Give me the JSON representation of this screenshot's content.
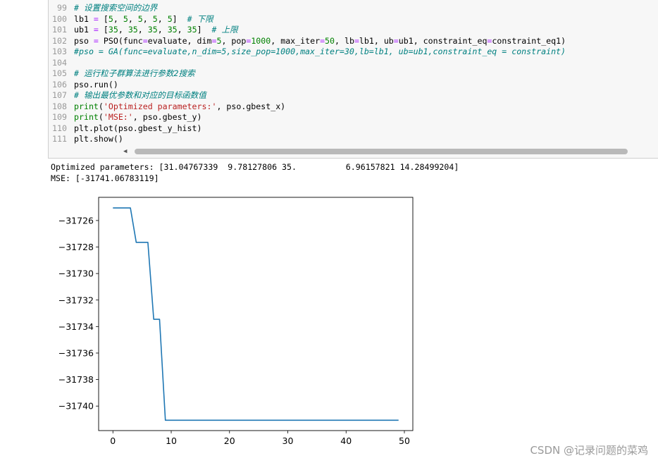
{
  "code_lines": [
    {
      "num": "99",
      "segs": [
        {
          "t": "# 设置搜索空间的边界",
          "c": "c"
        }
      ]
    },
    {
      "num": "100",
      "segs": [
        {
          "t": "lb1 ",
          "c": "src"
        },
        {
          "t": "=",
          "c": "e"
        },
        {
          "t": " [",
          "c": "src"
        },
        {
          "t": "5",
          "c": "n"
        },
        {
          "t": ", ",
          "c": "src"
        },
        {
          "t": "5",
          "c": "n"
        },
        {
          "t": ", ",
          "c": "src"
        },
        {
          "t": "5",
          "c": "n"
        },
        {
          "t": ", ",
          "c": "src"
        },
        {
          "t": "5",
          "c": "n"
        },
        {
          "t": ", ",
          "c": "src"
        },
        {
          "t": "5",
          "c": "n"
        },
        {
          "t": "]  ",
          "c": "src"
        },
        {
          "t": "# 下限",
          "c": "c"
        }
      ]
    },
    {
      "num": "101",
      "segs": [
        {
          "t": "ub1 ",
          "c": "src"
        },
        {
          "t": "=",
          "c": "e"
        },
        {
          "t": " [",
          "c": "src"
        },
        {
          "t": "35",
          "c": "n"
        },
        {
          "t": ", ",
          "c": "src"
        },
        {
          "t": "35",
          "c": "n"
        },
        {
          "t": ", ",
          "c": "src"
        },
        {
          "t": "35",
          "c": "n"
        },
        {
          "t": ", ",
          "c": "src"
        },
        {
          "t": "35",
          "c": "n"
        },
        {
          "t": ", ",
          "c": "src"
        },
        {
          "t": "35",
          "c": "n"
        },
        {
          "t": "]  ",
          "c": "src"
        },
        {
          "t": "# 上限",
          "c": "c"
        }
      ]
    },
    {
      "num": "102",
      "segs": [
        {
          "t": "pso ",
          "c": "src"
        },
        {
          "t": "=",
          "c": "e"
        },
        {
          "t": " PSO(func",
          "c": "src"
        },
        {
          "t": "=",
          "c": "e"
        },
        {
          "t": "evaluate, dim",
          "c": "src"
        },
        {
          "t": "=",
          "c": "e"
        },
        {
          "t": "5",
          "c": "n"
        },
        {
          "t": ", pop",
          "c": "src"
        },
        {
          "t": "=",
          "c": "e"
        },
        {
          "t": "1000",
          "c": "n"
        },
        {
          "t": ", max_iter",
          "c": "src"
        },
        {
          "t": "=",
          "c": "e"
        },
        {
          "t": "50",
          "c": "n"
        },
        {
          "t": ", lb",
          "c": "src"
        },
        {
          "t": "=",
          "c": "e"
        },
        {
          "t": "lb1, ub",
          "c": "src"
        },
        {
          "t": "=",
          "c": "e"
        },
        {
          "t": "ub1, constraint_eq",
          "c": "src"
        },
        {
          "t": "=",
          "c": "e"
        },
        {
          "t": "constraint_eq1)",
          "c": "src"
        }
      ]
    },
    {
      "num": "103",
      "segs": [
        {
          "t": "#pso = GA(func=evaluate,n_dim=5,size_pop=1000,max_iter=30,lb=lb1, ub=ub1,constraint_eq = constraint)",
          "c": "c"
        }
      ]
    },
    {
      "num": "104",
      "segs": []
    },
    {
      "num": "105",
      "segs": [
        {
          "t": "# 运行粒子群算法进行参数2搜索",
          "c": "c"
        }
      ]
    },
    {
      "num": "106",
      "segs": [
        {
          "t": "pso.run()",
          "c": "src"
        }
      ]
    },
    {
      "num": "107",
      "segs": [
        {
          "t": "# 输出最优参数和对应的目标函数值",
          "c": "c"
        }
      ]
    },
    {
      "num": "108",
      "segs": [
        {
          "t": "print",
          "c": "n"
        },
        {
          "t": "(",
          "c": "src"
        },
        {
          "t": "'Optimized parameters:'",
          "c": "s"
        },
        {
          "t": ", pso.gbest_x)",
          "c": "src"
        }
      ]
    },
    {
      "num": "109",
      "segs": [
        {
          "t": "print",
          "c": "n"
        },
        {
          "t": "(",
          "c": "src"
        },
        {
          "t": "'MSE:'",
          "c": "s"
        },
        {
          "t": ", pso.gbest_y)",
          "c": "src"
        }
      ]
    },
    {
      "num": "110",
      "segs": [
        {
          "t": "plt.plot(pso.gbest_y_hist)",
          "c": "src"
        }
      ]
    },
    {
      "num": "111",
      "segs": [
        {
          "t": "plt.show()",
          "c": "src"
        }
      ]
    }
  ],
  "output": {
    "line1": "Optimized parameters: [31.04767339  9.78127806 35.          6.96157821 14.28499204]",
    "line2": "MSE: [-31741.06783119]"
  },
  "chart_data": {
    "type": "line",
    "title": "",
    "xlabel": "",
    "ylabel": "",
    "xlim": [
      -2.45,
      51.45
    ],
    "ylim": [
      -31741.85,
      -31724.25
    ],
    "xticks": [
      0,
      10,
      20,
      30,
      40,
      50
    ],
    "yticks": [
      -31726,
      -31728,
      -31730,
      -31732,
      -31734,
      -31736,
      -31738,
      -31740
    ],
    "ytick_labels": [
      "−31726",
      "−31728",
      "−31730",
      "−31732",
      "−31734",
      "−31736",
      "−31738",
      "−31740"
    ],
    "grid": false,
    "color": "#1f77b4",
    "series": [
      {
        "x": [
          0,
          1,
          2,
          3,
          4,
          5,
          6,
          7,
          8,
          9,
          10,
          11,
          12,
          13,
          14,
          15,
          16,
          17,
          18,
          19,
          20,
          21,
          22,
          23,
          24,
          25,
          26,
          27,
          28,
          29,
          30,
          31,
          32,
          33,
          34,
          35,
          36,
          37,
          38,
          39,
          40,
          41,
          42,
          43,
          44,
          45,
          46,
          47,
          48,
          49
        ],
        "y": [
          -31725.05,
          -31725.05,
          -31725.05,
          -31725.05,
          -31727.65,
          -31727.65,
          -31727.65,
          -31733.45,
          -31733.45,
          -31741.07,
          -31741.07,
          -31741.07,
          -31741.07,
          -31741.07,
          -31741.07,
          -31741.07,
          -31741.07,
          -31741.07,
          -31741.07,
          -31741.07,
          -31741.07,
          -31741.07,
          -31741.07,
          -31741.07,
          -31741.07,
          -31741.07,
          -31741.07,
          -31741.07,
          -31741.07,
          -31741.07,
          -31741.07,
          -31741.07,
          -31741.07,
          -31741.07,
          -31741.07,
          -31741.07,
          -31741.07,
          -31741.07,
          -31741.07,
          -31741.07,
          -31741.07,
          -31741.07,
          -31741.07,
          -31741.07,
          -31741.07,
          -31741.07,
          -31741.07,
          -31741.07,
          -31741.07,
          -31741.07
        ]
      }
    ]
  },
  "watermark": "CSDN @记录问题的菜鸡"
}
